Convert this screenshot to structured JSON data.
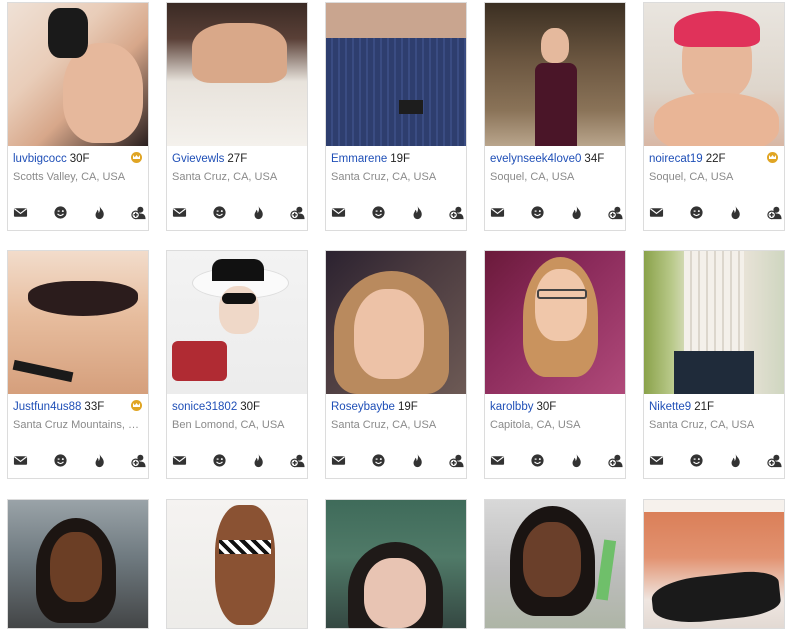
{
  "profiles": [
    {
      "username": "luvbigcocc",
      "age_sex": "30F",
      "location": "Scotts Valley, CA, USA",
      "premium": true
    },
    {
      "username": "Gvievewls",
      "age_sex": "27F",
      "location": "Santa Cruz, CA, USA",
      "premium": false
    },
    {
      "username": "Emmarene",
      "age_sex": "19F",
      "location": "Santa Cruz, CA, USA",
      "premium": false
    },
    {
      "username": "evelynseek4love0",
      "age_sex": "34F",
      "location": "Soquel, CA, USA",
      "premium": false
    },
    {
      "username": "noirecat19",
      "age_sex": "22F",
      "location": "Soquel, CA, USA",
      "premium": true
    },
    {
      "username": "Justfun4us88",
      "age_sex": "33F",
      "location": "Santa Cruz Mountains, CA...",
      "premium": true
    },
    {
      "username": "sonice31802",
      "age_sex": "30F",
      "location": "Ben Lomond, CA, USA",
      "premium": false
    },
    {
      "username": "Roseybaybe",
      "age_sex": "19F",
      "location": "Santa Cruz, CA, USA",
      "premium": false
    },
    {
      "username": "karolbby",
      "age_sex": "30F",
      "location": "Capitola, CA, USA",
      "premium": false
    },
    {
      "username": "Nikette9",
      "age_sex": "21F",
      "location": "Santa Cruz, CA, USA",
      "premium": false
    },
    {
      "username": "",
      "age_sex": "",
      "location": "",
      "premium": false
    },
    {
      "username": "",
      "age_sex": "",
      "location": "",
      "premium": false
    },
    {
      "username": "",
      "age_sex": "",
      "location": "",
      "premium": false
    },
    {
      "username": "",
      "age_sex": "",
      "location": "",
      "premium": false
    },
    {
      "username": "",
      "age_sex": "",
      "location": "",
      "premium": false
    }
  ],
  "action_icons": [
    "mail-icon",
    "wink-icon",
    "flame-icon",
    "add-friend-icon"
  ],
  "colors": {
    "username_link": "#1f4fb7",
    "location_text": "#8a8a8a",
    "premium_badge": "#e0a524",
    "card_border": "#dcdcdc",
    "icon": "#333333"
  }
}
